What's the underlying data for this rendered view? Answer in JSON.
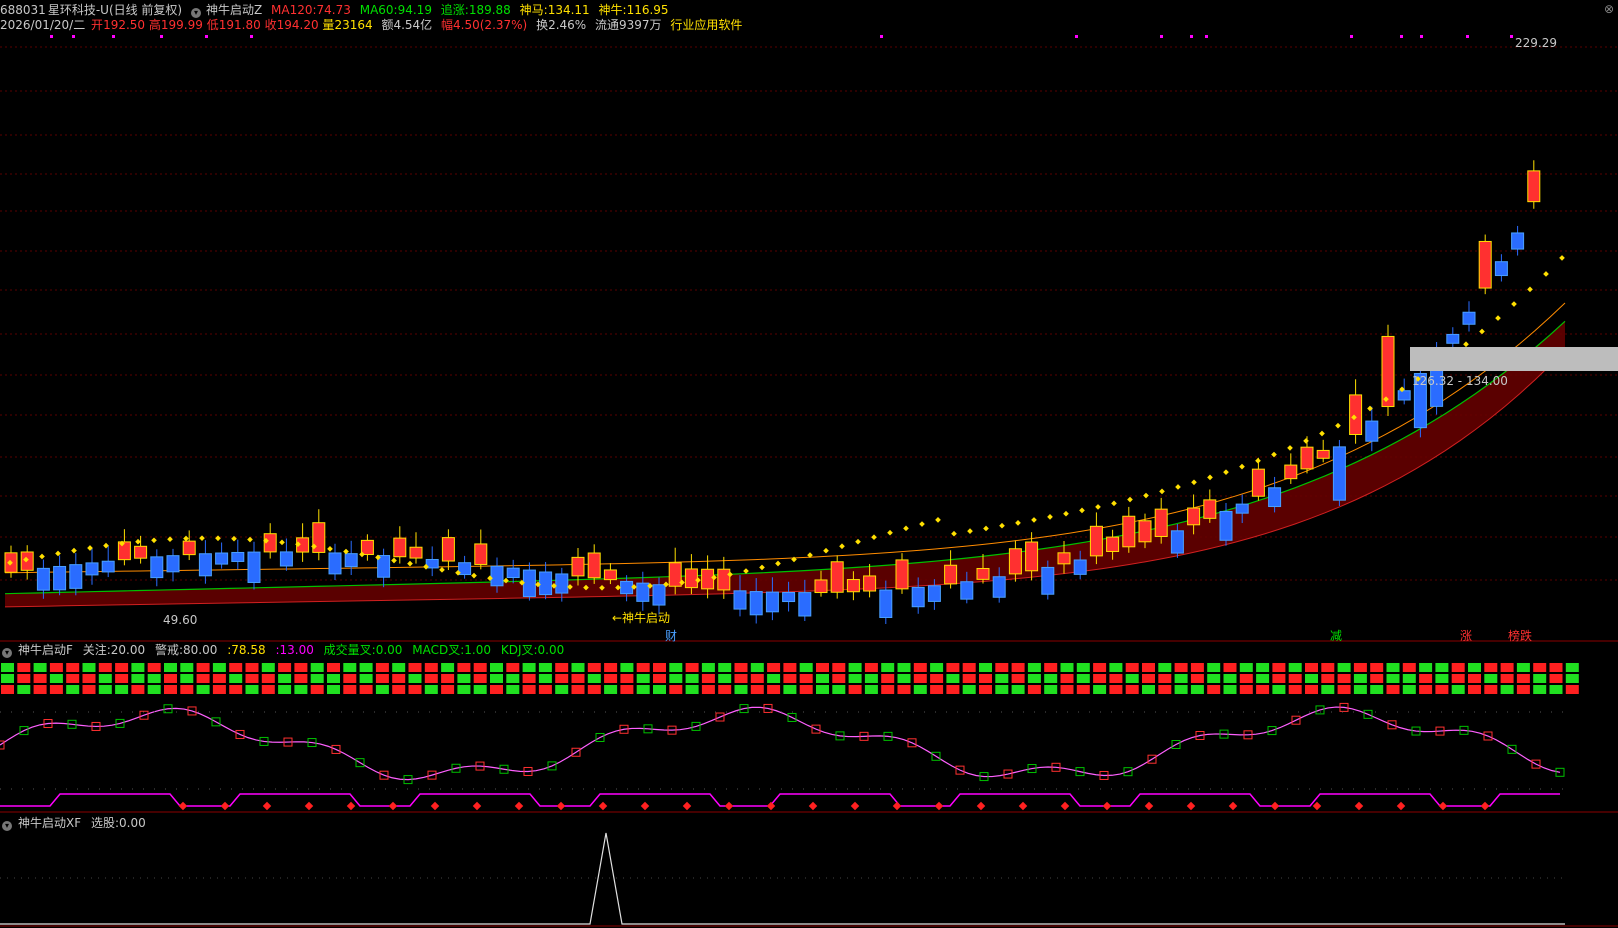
{
  "header": {
    "code": "688031",
    "name": "星环科技-U",
    "period": "(日线 前复权)",
    "indicator": "神牛启动Z",
    "ma120_label": "MA120:",
    "ma120": "74.73",
    "ma60_label": "MA60:",
    "ma60": "94.19",
    "zhuizhang_label": "追涨:",
    "zhuizhang": "189.88",
    "shenma_label": "神马:",
    "shenma": "134.11",
    "shenniu_label": "神牛:",
    "shenniu": "116.95"
  },
  "info": {
    "date": "2026/01/20/二",
    "open_label": "开",
    "open": "192.50",
    "high_label": "高",
    "high": "199.99",
    "low_label": "低",
    "low": "191.80",
    "close_label": "收",
    "close": "194.20",
    "vol_label": "量",
    "vol": "23164",
    "amount": "额4.54亿",
    "change_label": "幅",
    "change": "4.50(2.37%)",
    "turnover": "换2.46%",
    "float": "流通9397万",
    "industry": "行业应用软件"
  },
  "main_chart": {
    "high_label": "229.29",
    "low_label": "49.60",
    "zone_label": "126.32 - 134.00",
    "start_label": "←神牛启动",
    "marker_cai": "财",
    "marker_jian": "减",
    "marker_zhang": "涨",
    "marker_bangdie": "榜跌"
  },
  "panel2": {
    "title": "神牛启动F",
    "guanzhu_label": "关注:",
    "guanzhu": "20.00",
    "jingjie_label": "警戒:",
    "jingjie": "80.00",
    "value1": ":78.58",
    "value2": ":13.00",
    "vol_cross_label": "成交量叉:",
    "vol_cross": "0.00",
    "macd_label": "MACD叉:",
    "macd": "1.00",
    "kdj_label": "KDJ叉:",
    "kdj": "0.00"
  },
  "panel3": {
    "title": "神牛启动XF",
    "xuangu_label": "选股:",
    "xuangu": "0.00"
  },
  "colors": {
    "up": "#ff3030",
    "down": "#2a6cff",
    "ma60": "#00c000",
    "ma120": "#ff8c00",
    "dots": "#ffe000",
    "magenta": "#ff00ff",
    "grid": "#7a0000"
  }
}
